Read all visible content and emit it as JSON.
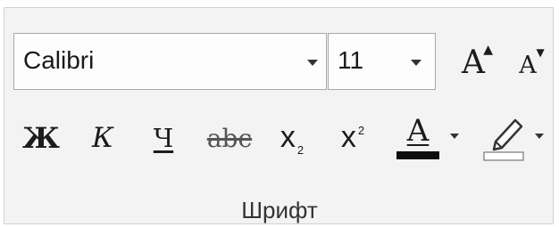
{
  "font_group": {
    "font_name": "Calibri",
    "font_size": "11",
    "label": "Шрифт",
    "grow_label": "A",
    "shrink_label": "A",
    "bold_label": "Ж",
    "italic_label": "К",
    "underline_label": "Ч",
    "strike_label": "abc",
    "subscript_label": "x",
    "subscript_mark": "2",
    "superscript_label": "x",
    "superscript_mark": "2",
    "font_color_label": "A"
  },
  "colors": {
    "font_color_bar": "#0d0d0d",
    "highlight_bar": "#ffffff"
  }
}
